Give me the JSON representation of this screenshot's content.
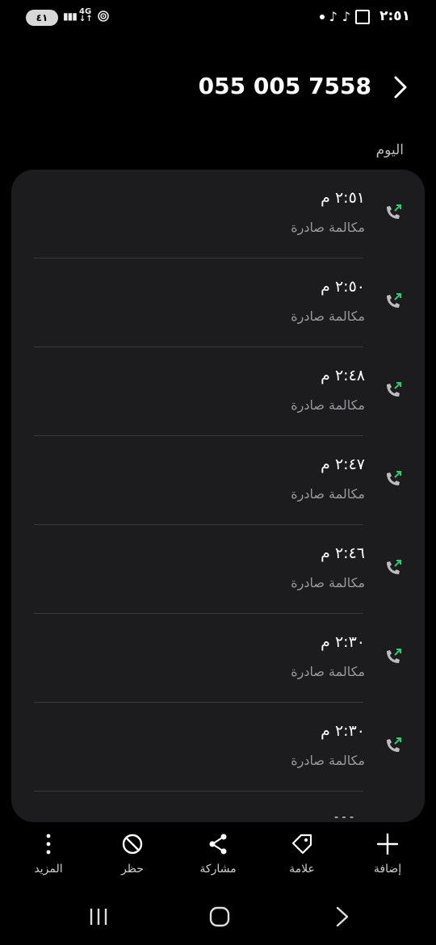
{
  "status_bar": {
    "battery": "٤١",
    "network": "4G",
    "time": "٢:٥١"
  },
  "header": {
    "number": "055 005 7558"
  },
  "section": {
    "label": "اليوم"
  },
  "calls": [
    {
      "time": "٢:٥١ م",
      "type": "مكالمة صادرة"
    },
    {
      "time": "٢:٥٠ م",
      "type": "مكالمة صادرة"
    },
    {
      "time": "٢:٤٨ م",
      "type": "مكالمة صادرة"
    },
    {
      "time": "٢:٤٧ م",
      "type": "مكالمة صادرة"
    },
    {
      "time": "٢:٤٦ م",
      "type": "مكالمة صادرة"
    },
    {
      "time": "٢:٣٠ م",
      "type": "مكالمة صادرة"
    },
    {
      "time": "٢:٣٠ م",
      "type": "مكالمة صادرة"
    }
  ],
  "actions": {
    "add": "إضافة",
    "tag": "علامة",
    "share": "مشاركة",
    "block": "حظر",
    "more": "المزيد"
  },
  "colors": {
    "outgoing_arrow": "#2ecc71",
    "card_bg": "#1c1c1e"
  }
}
